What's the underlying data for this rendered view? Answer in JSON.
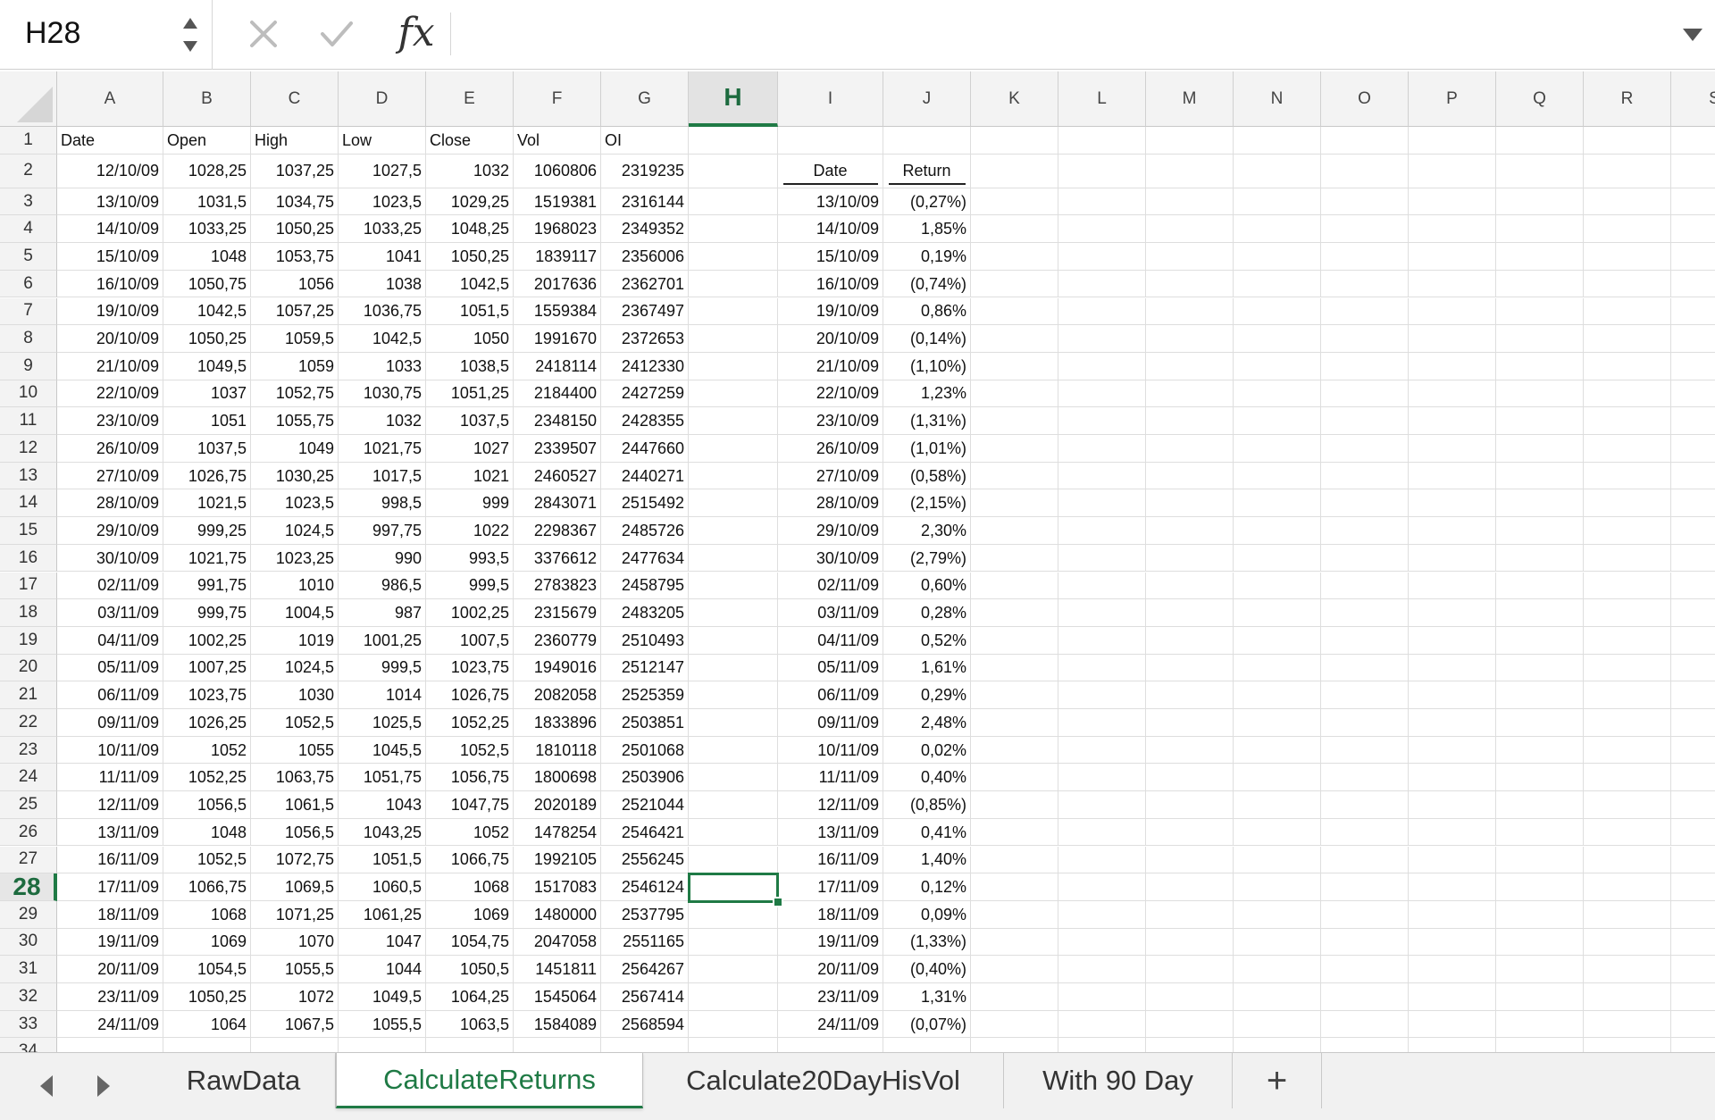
{
  "formula_bar": {
    "name_box": "H28",
    "fx_label": "fx",
    "formula": ""
  },
  "columns": [
    "A",
    "B",
    "C",
    "D",
    "E",
    "F",
    "G",
    "H",
    "I",
    "J",
    "K",
    "L",
    "M",
    "N",
    "O",
    "P",
    "Q",
    "R",
    "S"
  ],
  "selected_column": "H",
  "selected_row": 28,
  "data_headers": [
    "Date",
    "Open",
    "High",
    "Low",
    "Close",
    "Vol",
    "OI"
  ],
  "return_headers": [
    "Date",
    "Return"
  ],
  "rows": [
    [
      "12/10/09",
      "1028,25",
      "1037,25",
      "1027,5",
      "1032",
      "1060806",
      "2319235"
    ],
    [
      "13/10/09",
      "1031,5",
      "1034,75",
      "1023,5",
      "1029,25",
      "1519381",
      "2316144"
    ],
    [
      "14/10/09",
      "1033,25",
      "1050,25",
      "1033,25",
      "1048,25",
      "1968023",
      "2349352"
    ],
    [
      "15/10/09",
      "1048",
      "1053,75",
      "1041",
      "1050,25",
      "1839117",
      "2356006"
    ],
    [
      "16/10/09",
      "1050,75",
      "1056",
      "1038",
      "1042,5",
      "2017636",
      "2362701"
    ],
    [
      "19/10/09",
      "1042,5",
      "1057,25",
      "1036,75",
      "1051,5",
      "1559384",
      "2367497"
    ],
    [
      "20/10/09",
      "1050,25",
      "1059,5",
      "1042,5",
      "1050",
      "1991670",
      "2372653"
    ],
    [
      "21/10/09",
      "1049,5",
      "1059",
      "1033",
      "1038,5",
      "2418114",
      "2412330"
    ],
    [
      "22/10/09",
      "1037",
      "1052,75",
      "1030,75",
      "1051,25",
      "2184400",
      "2427259"
    ],
    [
      "23/10/09",
      "1051",
      "1055,75",
      "1032",
      "1037,5",
      "2348150",
      "2428355"
    ],
    [
      "26/10/09",
      "1037,5",
      "1049",
      "1021,75",
      "1027",
      "2339507",
      "2447660"
    ],
    [
      "27/10/09",
      "1026,75",
      "1030,25",
      "1017,5",
      "1021",
      "2460527",
      "2440271"
    ],
    [
      "28/10/09",
      "1021,5",
      "1023,5",
      "998,5",
      "999",
      "2843071",
      "2515492"
    ],
    [
      "29/10/09",
      "999,25",
      "1024,5",
      "997,75",
      "1022",
      "2298367",
      "2485726"
    ],
    [
      "30/10/09",
      "1021,75",
      "1023,25",
      "990",
      "993,5",
      "3376612",
      "2477634"
    ],
    [
      "02/11/09",
      "991,75",
      "1010",
      "986,5",
      "999,5",
      "2783823",
      "2458795"
    ],
    [
      "03/11/09",
      "999,75",
      "1004,5",
      "987",
      "1002,25",
      "2315679",
      "2483205"
    ],
    [
      "04/11/09",
      "1002,25",
      "1019",
      "1001,25",
      "1007,5",
      "2360779",
      "2510493"
    ],
    [
      "05/11/09",
      "1007,25",
      "1024,5",
      "999,5",
      "1023,75",
      "1949016",
      "2512147"
    ],
    [
      "06/11/09",
      "1023,75",
      "1030",
      "1014",
      "1026,75",
      "2082058",
      "2525359"
    ],
    [
      "09/11/09",
      "1026,25",
      "1052,5",
      "1025,5",
      "1052,25",
      "1833896",
      "2503851"
    ],
    [
      "10/11/09",
      "1052",
      "1055",
      "1045,5",
      "1052,5",
      "1810118",
      "2501068"
    ],
    [
      "11/11/09",
      "1052,25",
      "1063,75",
      "1051,75",
      "1056,75",
      "1800698",
      "2503906"
    ],
    [
      "12/11/09",
      "1056,5",
      "1061,5",
      "1043",
      "1047,75",
      "2020189",
      "2521044"
    ],
    [
      "13/11/09",
      "1048",
      "1056,5",
      "1043,25",
      "1052",
      "1478254",
      "2546421"
    ],
    [
      "16/11/09",
      "1052,5",
      "1072,75",
      "1051,5",
      "1066,75",
      "1992105",
      "2556245"
    ],
    [
      "17/11/09",
      "1066,75",
      "1069,5",
      "1060,5",
      "1068",
      "1517083",
      "2546124"
    ],
    [
      "18/11/09",
      "1068",
      "1071,25",
      "1061,25",
      "1069",
      "1480000",
      "2537795"
    ],
    [
      "19/11/09",
      "1069",
      "1070",
      "1047",
      "1054,75",
      "2047058",
      "2551165"
    ],
    [
      "20/11/09",
      "1054,5",
      "1055,5",
      "1044",
      "1050,5",
      "1451811",
      "2564267"
    ],
    [
      "23/11/09",
      "1050,25",
      "1072",
      "1049,5",
      "1064,25",
      "1545064",
      "2567414"
    ],
    [
      "24/11/09",
      "1064",
      "1067,5",
      "1055,5",
      "1063,5",
      "1584089",
      "2568594"
    ]
  ],
  "returns": [
    [
      "13/10/09",
      "(0,27%)"
    ],
    [
      "14/10/09",
      "1,85%"
    ],
    [
      "15/10/09",
      "0,19%"
    ],
    [
      "16/10/09",
      "(0,74%)"
    ],
    [
      "19/10/09",
      "0,86%"
    ],
    [
      "20/10/09",
      "(0,14%)"
    ],
    [
      "21/10/09",
      "(1,10%)"
    ],
    [
      "22/10/09",
      "1,23%"
    ],
    [
      "23/10/09",
      "(1,31%)"
    ],
    [
      "26/10/09",
      "(1,01%)"
    ],
    [
      "27/10/09",
      "(0,58%)"
    ],
    [
      "28/10/09",
      "(2,15%)"
    ],
    [
      "29/10/09",
      "2,30%"
    ],
    [
      "30/10/09",
      "(2,79%)"
    ],
    [
      "02/11/09",
      "0,60%"
    ],
    [
      "03/11/09",
      "0,28%"
    ],
    [
      "04/11/09",
      "0,52%"
    ],
    [
      "05/11/09",
      "1,61%"
    ],
    [
      "06/11/09",
      "0,29%"
    ],
    [
      "09/11/09",
      "2,48%"
    ],
    [
      "10/11/09",
      "0,02%"
    ],
    [
      "11/11/09",
      "0,40%"
    ],
    [
      "12/11/09",
      "(0,85%)"
    ],
    [
      "13/11/09",
      "0,41%"
    ],
    [
      "16/11/09",
      "1,40%"
    ],
    [
      "17/11/09",
      "0,12%"
    ],
    [
      "18/11/09",
      "0,09%"
    ],
    [
      "19/11/09",
      "(1,33%)"
    ],
    [
      "20/11/09",
      "(0,40%)"
    ],
    [
      "23/11/09",
      "1,31%"
    ],
    [
      "24/11/09",
      "(0,07%)"
    ]
  ],
  "sheet_tabs": [
    "RawData",
    "CalculateReturns",
    "Calculate20DayHisVol",
    "With 90 Day"
  ],
  "active_tab": "CalculateReturns",
  "add_sheet_label": "+",
  "colors": {
    "accent": "#1f7a45",
    "header_bg": "#f3f3f3",
    "gridline": "#dedede"
  },
  "icons": {
    "cancel": "x-icon",
    "confirm": "checkmark-icon",
    "function": "fx-icon",
    "prev_sheet": "chevron-left-icon",
    "next_sheet": "chevron-right-icon",
    "add_sheet": "plus-icon",
    "formula_expand": "chevron-down-icon"
  }
}
